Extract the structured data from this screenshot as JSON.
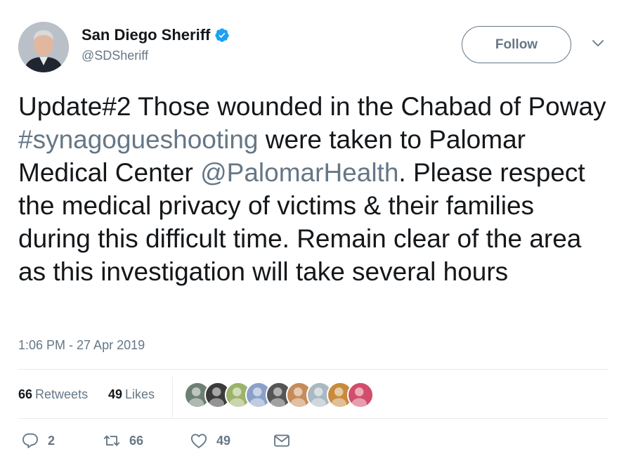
{
  "author": {
    "display_name": "San Diego Sheriff",
    "handle": "@SDSheriff",
    "verified": true
  },
  "follow_button": {
    "label": "Follow"
  },
  "tweet": {
    "segments": [
      {
        "text": "Update#2 Those wounded in the Chabad of Poway ",
        "link": false
      },
      {
        "text": "#synagogueshooting",
        "link": true
      },
      {
        "text": " were taken to Palomar Medical Center ",
        "link": false
      },
      {
        "text": "@PalomarHealth",
        "link": true
      },
      {
        "text": ". Please respect the medical privacy of victims & their families during this difficult time. Remain clear of the area as this investigation will take several hours",
        "link": false
      }
    ],
    "timestamp": "1:06 PM - 27 Apr 2019"
  },
  "stats": {
    "retweets_count": "66",
    "retweets_label": "Retweets",
    "likes_count": "49",
    "likes_label": "Likes"
  },
  "likers": [
    {
      "icon": "avatar-man-photo",
      "color": "#6d7f73"
    },
    {
      "icon": "avatar-cat-photo",
      "color": "#3b3b3b"
    },
    {
      "icon": "avatar-animal-photo",
      "color": "#9bb36a"
    },
    {
      "icon": "avatar-man-photo",
      "color": "#8aa0c8"
    },
    {
      "icon": "avatar-illustration",
      "color": "#555555"
    },
    {
      "icon": "avatar-woman-photo",
      "color": "#c68b5a"
    },
    {
      "icon": "avatar-default-egg",
      "color": "#aab8c2"
    },
    {
      "icon": "avatar-animal-photo",
      "color": "#c98a3c"
    },
    {
      "icon": "avatar-woman-photo",
      "color": "#d14d6b"
    }
  ],
  "actions": {
    "reply_count": "2",
    "retweet_count": "66",
    "like_count": "49"
  },
  "colors": {
    "text": "#14171a",
    "muted": "#657786",
    "verified_blue": "#1da1f2",
    "divider": "#e6ecf0"
  }
}
